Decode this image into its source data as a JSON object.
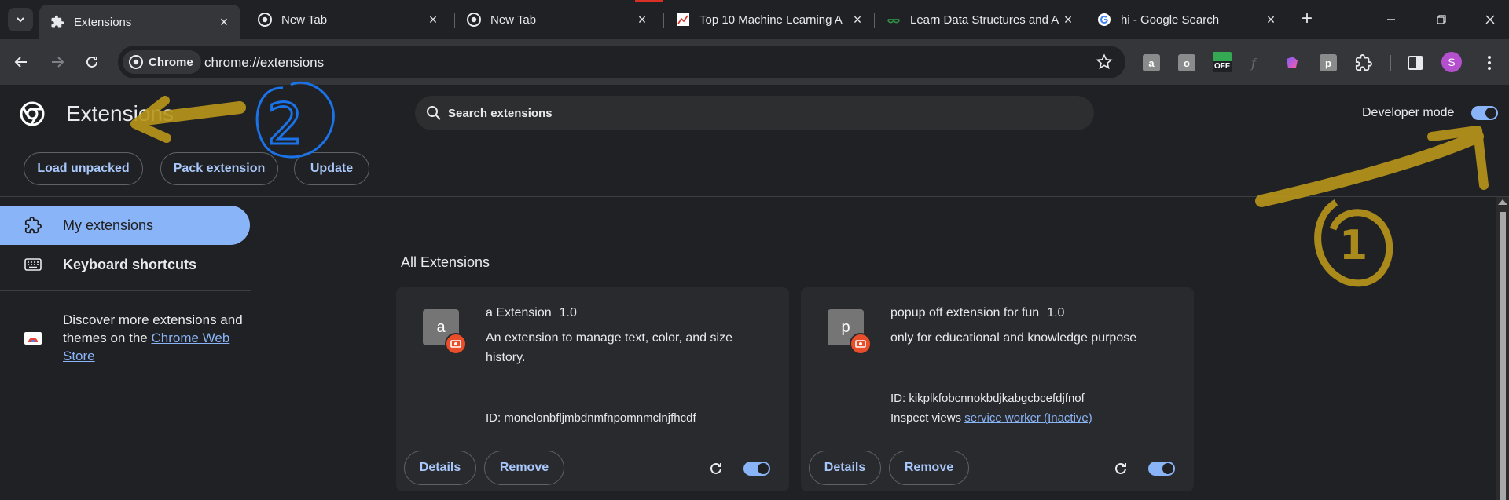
{
  "browser": {
    "tabs": [
      {
        "title": "Extensions",
        "favicon": "puzzle-icon",
        "active": true
      },
      {
        "title": "New Tab",
        "favicon": "chrome-icon",
        "active": false
      },
      {
        "title": "New Tab",
        "favicon": "chrome-icon",
        "active": false
      },
      {
        "title": "Top 10 Machine Learning A",
        "favicon": "chart-favicon",
        "active": false
      },
      {
        "title": "Learn Data Structures and A",
        "favicon": "gfg-favicon",
        "active": false
      },
      {
        "title": "hi - Google Search",
        "favicon": "google-favicon",
        "active": false
      }
    ],
    "omnibox": {
      "chip_label": "Chrome",
      "url": "chrome://extensions"
    },
    "toolbar_extensions": [
      "a",
      "o",
      "OFF",
      "p"
    ],
    "profile_initial": "S"
  },
  "header": {
    "title": "Extensions",
    "search_placeholder": "Search extensions",
    "developer_mode_label": "Developer mode",
    "developer_mode_on": true,
    "buttons": {
      "load_unpacked": "Load unpacked",
      "pack_extension": "Pack extension",
      "update": "Update"
    }
  },
  "sidebar": {
    "items": [
      {
        "label": "My extensions",
        "icon": "extension-icon",
        "active": true
      },
      {
        "label": "Keyboard shortcuts",
        "icon": "keyboard-icon",
        "active": false
      }
    ],
    "discover_prefix": "Discover more extensions and themes on the ",
    "discover_link": "Chrome Web Store"
  },
  "main": {
    "section_title": "All Extensions",
    "extensions": [
      {
        "letter": "a",
        "name": "a Extension",
        "version": "1.0",
        "description": "An extension to manage text, color, and size history.",
        "id_text": "ID: monelonbfljmbdnmfnpomnmclnjfhcdf",
        "inspect_label": "",
        "inspect_link": "",
        "enabled": true,
        "details_label": "Details",
        "remove_label": "Remove"
      },
      {
        "letter": "p",
        "name": "popup off extension for fun",
        "version": "1.0",
        "description": "only for educational and knowledge purpose",
        "id_text": "ID: kikplkfobcnnokbdjkabgcbcefdjfnof",
        "inspect_label": "Inspect views ",
        "inspect_link": "service worker (Inactive)",
        "enabled": true,
        "details_label": "Details",
        "remove_label": "Remove"
      }
    ]
  },
  "annotations": {
    "number_one": "1",
    "number_two": "2"
  },
  "colors": {
    "accent": "#8ab4f8",
    "button_text": "#a8c7fa",
    "background": "#202124",
    "card": "#292a2d",
    "annotation_gold": "#b8961a",
    "annotation_blue": "#1a73e8"
  }
}
